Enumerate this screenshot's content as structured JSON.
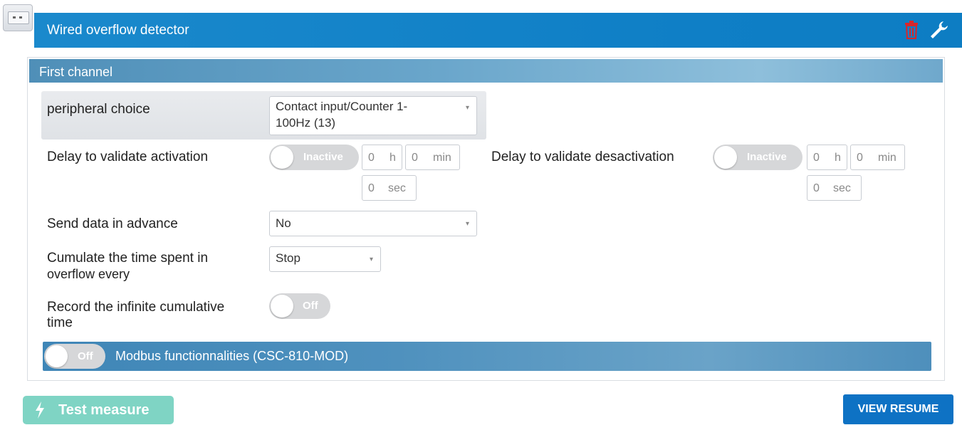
{
  "header": {
    "title": "Wired overflow detector",
    "icons": [
      "trash-icon",
      "wrench-icon"
    ],
    "accent": "#0f7fc6"
  },
  "channel": {
    "title": "First channel"
  },
  "peripheral": {
    "label": "peripheral choice",
    "value_line1": "Contact input/Counter 1-",
    "value_line2": "100Hz (13)"
  },
  "activation": {
    "label": "Delay to validate activation",
    "toggle": "Inactive",
    "hours": "0",
    "hours_unit": "h",
    "minutes": "0",
    "minutes_unit": "min",
    "seconds": "0",
    "seconds_unit": "sec"
  },
  "deactivation": {
    "label": "Delay to validate desactivation",
    "toggle": "Inactive",
    "hours": "0",
    "hours_unit": "h",
    "minutes": "0",
    "minutes_unit": "min",
    "seconds": "0",
    "seconds_unit": "sec"
  },
  "send_advance": {
    "label": "Send data in advance",
    "value": "No"
  },
  "cumulate": {
    "label_line1": "Cumulate the time spent in",
    "label_line2": "overflow every",
    "value": "Stop"
  },
  "record": {
    "label_line1": "Record the infinite cumulative",
    "label_line2": "time",
    "toggle": "Off"
  },
  "modbus": {
    "toggle": "Off",
    "title": "Modbus functionnalities (CSC-810-MOD)"
  },
  "footer": {
    "test_label": "Test measure",
    "resume_label": "VIEW RESUME",
    "test_color": "#7fd4c4",
    "resume_color": "#0e72c4"
  }
}
